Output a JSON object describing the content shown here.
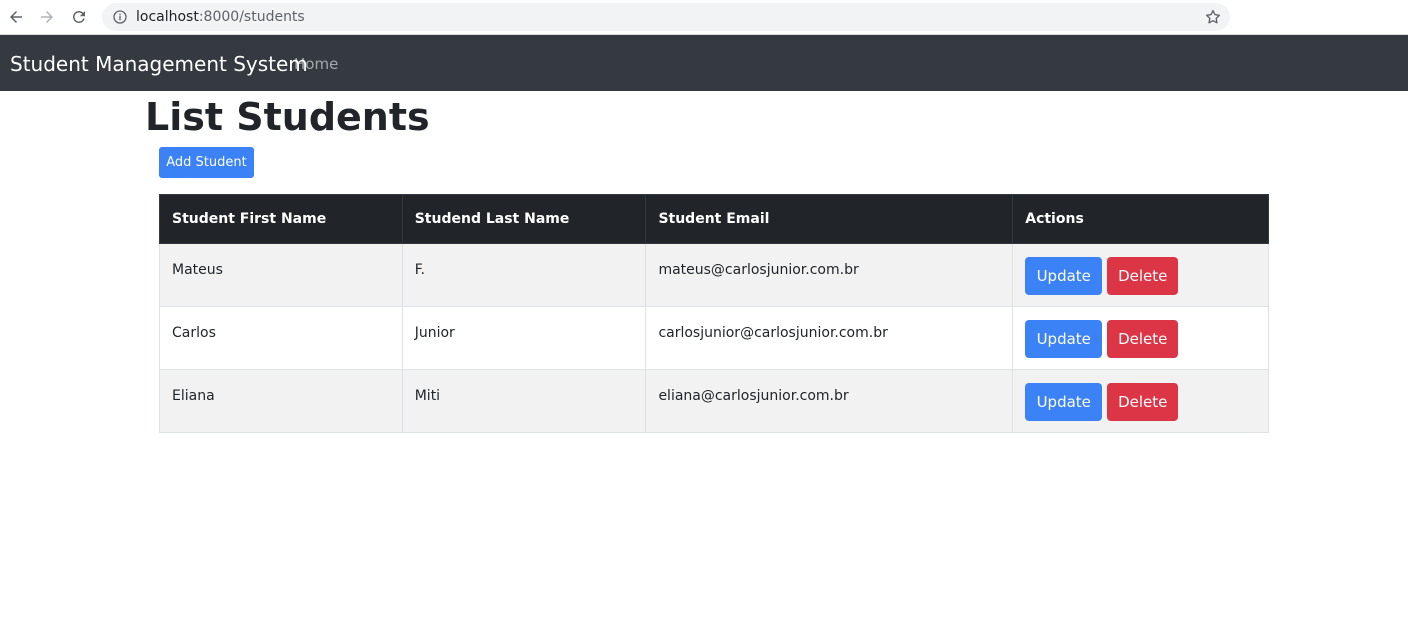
{
  "browser": {
    "url_host": "localhost",
    "url_path": ":8000/students"
  },
  "navbar": {
    "brand": "Student Management System",
    "home": "Home"
  },
  "page": {
    "title": "List Students",
    "add_button": "Add Student"
  },
  "table": {
    "headers": [
      "Student First Name",
      "Studend Last Name",
      "Student Email",
      "Actions"
    ],
    "rows": [
      {
        "first": "Mateus",
        "last": "F.",
        "email": "mateus@carlosjunior.com.br",
        "update": "Update",
        "delete": "Delete"
      },
      {
        "first": "Carlos",
        "last": "Junior",
        "email": "carlosjunior@carlosjunior.com.br",
        "update": "Update",
        "delete": "Delete"
      },
      {
        "first": "Eliana",
        "last": "Miti",
        "email": "eliana@carlosjunior.com.br",
        "update": "Update",
        "delete": "Delete"
      }
    ]
  },
  "colors": {
    "navbar_bg": "#343a40",
    "table_header_bg": "#212529",
    "primary": "#3b82f6",
    "danger": "#dc3545"
  },
  "icons": {
    "back": "arrow-left-icon",
    "forward": "arrow-right-icon",
    "reload": "reload-icon",
    "info": "info-icon",
    "bookmark": "star-icon"
  }
}
